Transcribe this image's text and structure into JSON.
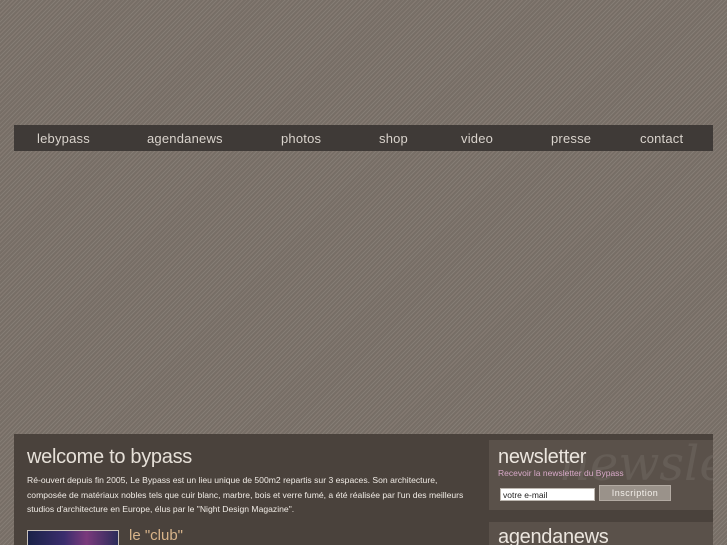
{
  "nav": {
    "items": [
      {
        "label": "lebypass"
      },
      {
        "label": "agendanews"
      },
      {
        "label": "photos"
      },
      {
        "label": "shop"
      },
      {
        "label": "video"
      },
      {
        "label": "presse"
      },
      {
        "label": "contact"
      }
    ]
  },
  "welcome": {
    "title": "welcome to bypass",
    "text": "Ré-ouvert depuis fin 2005, Le Bypass est un lieu unique de 500m2 repartis sur 3 espaces. Son architecture, composée de matériaux nobles tels que cuir blanc, marbre, bois et verre fumé, a été réalisée par l'un des meilleurs studios d'architecture en Europe, élus par le \"Night Design Magazine\"."
  },
  "club": {
    "title": "le \"club\""
  },
  "newsletter": {
    "title": "newsletter",
    "subtitle": "Recevoir la newsletter du Bypass",
    "email_value": "votre e-mail",
    "button_label": "Inscription",
    "watermark": "newsletter"
  },
  "agenda": {
    "title": "agendanews"
  }
}
